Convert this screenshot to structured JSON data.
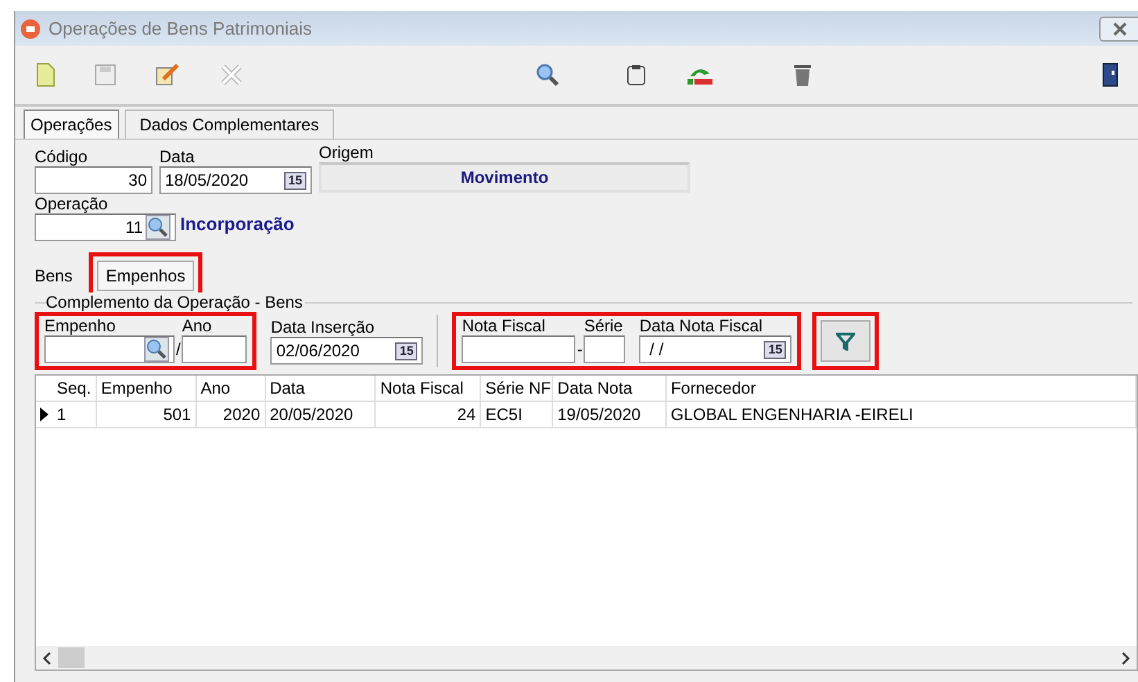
{
  "window": {
    "title": "Operações de Bens Patrimoniais"
  },
  "tabs": [
    {
      "label": "Operações",
      "selected": true
    },
    {
      "label": "Dados Complementares",
      "selected": false
    }
  ],
  "header": {
    "codigo": {
      "label": "Código",
      "value": "30"
    },
    "data": {
      "label": "Data",
      "value": "18/05/2020",
      "calendar": "15"
    },
    "origem": {
      "label": "Origem",
      "value": "Movimento"
    },
    "operacao": {
      "label": "Operação",
      "value": "11",
      "description": "Incorporação"
    }
  },
  "subtabs": [
    {
      "label": "Bens",
      "selected": false
    },
    {
      "label": "Empenhos",
      "selected": true
    }
  ],
  "group": {
    "title": "Complemento da Operação - Bens",
    "empenho": {
      "label": "Empenho"
    },
    "separator": "/",
    "ano": {
      "label": "Ano"
    },
    "data_insercao": {
      "label": "Data Inserção",
      "value": "02/06/2020",
      "calendar": "15"
    },
    "nota_fiscal": {
      "label": "Nota Fiscal"
    },
    "dash": "-",
    "serie": {
      "label": "Série"
    },
    "data_nota": {
      "label": "Data Nota Fiscal",
      "value": " / /",
      "calendar": "15"
    }
  },
  "table": {
    "columns": [
      "Seq.",
      "Empenho",
      "Ano",
      "Data",
      "Nota Fiscal",
      "Série NF",
      "Data Nota",
      "Fornecedor"
    ],
    "rows": [
      {
        "selected": true,
        "cells": [
          "1",
          "501",
          "2020",
          "20/05/2020",
          "24",
          "EC5I",
          "19/05/2020",
          "GLOBAL ENGENHARIA -EIRELI"
        ]
      }
    ]
  }
}
